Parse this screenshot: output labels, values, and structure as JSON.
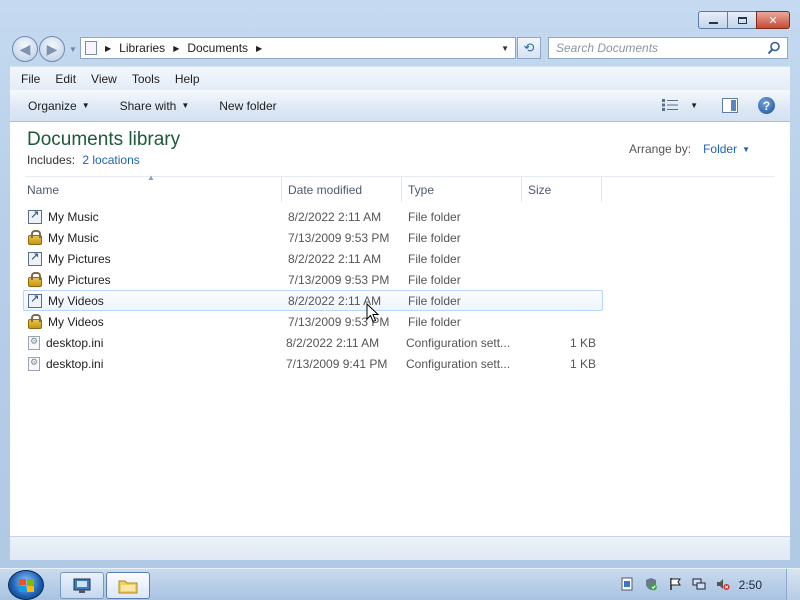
{
  "window": {
    "minimize_icon": "minimize-icon",
    "maximize_icon": "maximize-icon",
    "close_icon": "close-icon",
    "close_glyph": "✕"
  },
  "nav": {
    "back_glyph": "◀",
    "forward_glyph": "▶",
    "address": {
      "crumbs": [
        "Libraries",
        "Documents"
      ]
    },
    "search_placeholder": "Search Documents"
  },
  "menu": {
    "items": [
      "File",
      "Edit",
      "View",
      "Tools",
      "Help"
    ]
  },
  "toolbar": {
    "organize": "Organize",
    "share_with": "Share with",
    "new_folder": "New folder",
    "help_glyph": "?"
  },
  "library": {
    "title": "Documents library",
    "includes_label": "Includes:",
    "includes_link": "2 locations",
    "arrange_label": "Arrange by:",
    "arrange_value": "Folder"
  },
  "columns": {
    "name": "Name",
    "date": "Date modified",
    "type": "Type",
    "size": "Size"
  },
  "files": [
    {
      "name": "My Music",
      "date": "8/2/2022 2:11 AM",
      "type": "File folder",
      "size": "",
      "icon": "shortcut"
    },
    {
      "name": "My Music",
      "date": "7/13/2009 9:53 PM",
      "type": "File folder",
      "size": "",
      "icon": "lock"
    },
    {
      "name": "My Pictures",
      "date": "8/2/2022 2:11 AM",
      "type": "File folder",
      "size": "",
      "icon": "shortcut"
    },
    {
      "name": "My Pictures",
      "date": "7/13/2009 9:53 PM",
      "type": "File folder",
      "size": "",
      "icon": "lock"
    },
    {
      "name": "My Videos",
      "date": "8/2/2022 2:11 AM",
      "type": "File folder",
      "size": "",
      "icon": "shortcut",
      "hover": true
    },
    {
      "name": "My Videos",
      "date": "7/13/2009 9:53 PM",
      "type": "File folder",
      "size": "",
      "icon": "lock"
    },
    {
      "name": "desktop.ini",
      "date": "8/2/2022 2:11 AM",
      "type": "Configuration sett...",
      "size": "1 KB",
      "icon": "file"
    },
    {
      "name": "desktop.ini",
      "date": "7/13/2009 9:41 PM",
      "type": "Configuration sett...",
      "size": "1 KB",
      "icon": "file"
    }
  ],
  "taskbar": {
    "clock": "2:50"
  },
  "colors": {
    "accent_link": "#1e62b2",
    "library_title": "#1e5a3c",
    "close_red": "#c74a33"
  }
}
